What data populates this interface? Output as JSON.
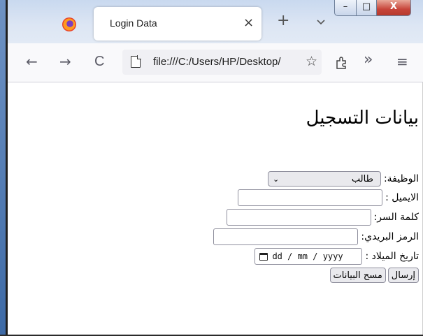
{
  "browser": {
    "tab_title": "Login Data",
    "tab_close": "×",
    "new_tab": "+",
    "url": "file:///C:/Users/HP/Desktop/",
    "icons": [
      "firefox-icon",
      "back-icon",
      "forward-icon",
      "reload-icon",
      "page-icon",
      "bookmark-star-icon",
      "extensions-icon",
      "overflow-icon",
      "menu-icon"
    ],
    "nav": {
      "back": "←",
      "forward": "→",
      "reload": "C",
      "star": "☆",
      "overflow": "»",
      "menu": "≡"
    },
    "window": {
      "minimize": "–",
      "maximize": "□",
      "close": "X"
    }
  },
  "page": {
    "heading": "بيانات التسجيل",
    "fields": {
      "job_label": "الوظيفة:",
      "job_value": "طالب",
      "email_label": "الايميل :",
      "email_value": "",
      "password_label": "كلمة السر:",
      "password_value": "",
      "postal_label": "الرمز البريدي:",
      "postal_value": "",
      "birthdate_label": "تاريخ الميلاد :",
      "birthdate_placeholder": "dd / mm / yyyy"
    },
    "buttons": {
      "submit": "إرسال",
      "clear": "مسح البيانات"
    }
  }
}
